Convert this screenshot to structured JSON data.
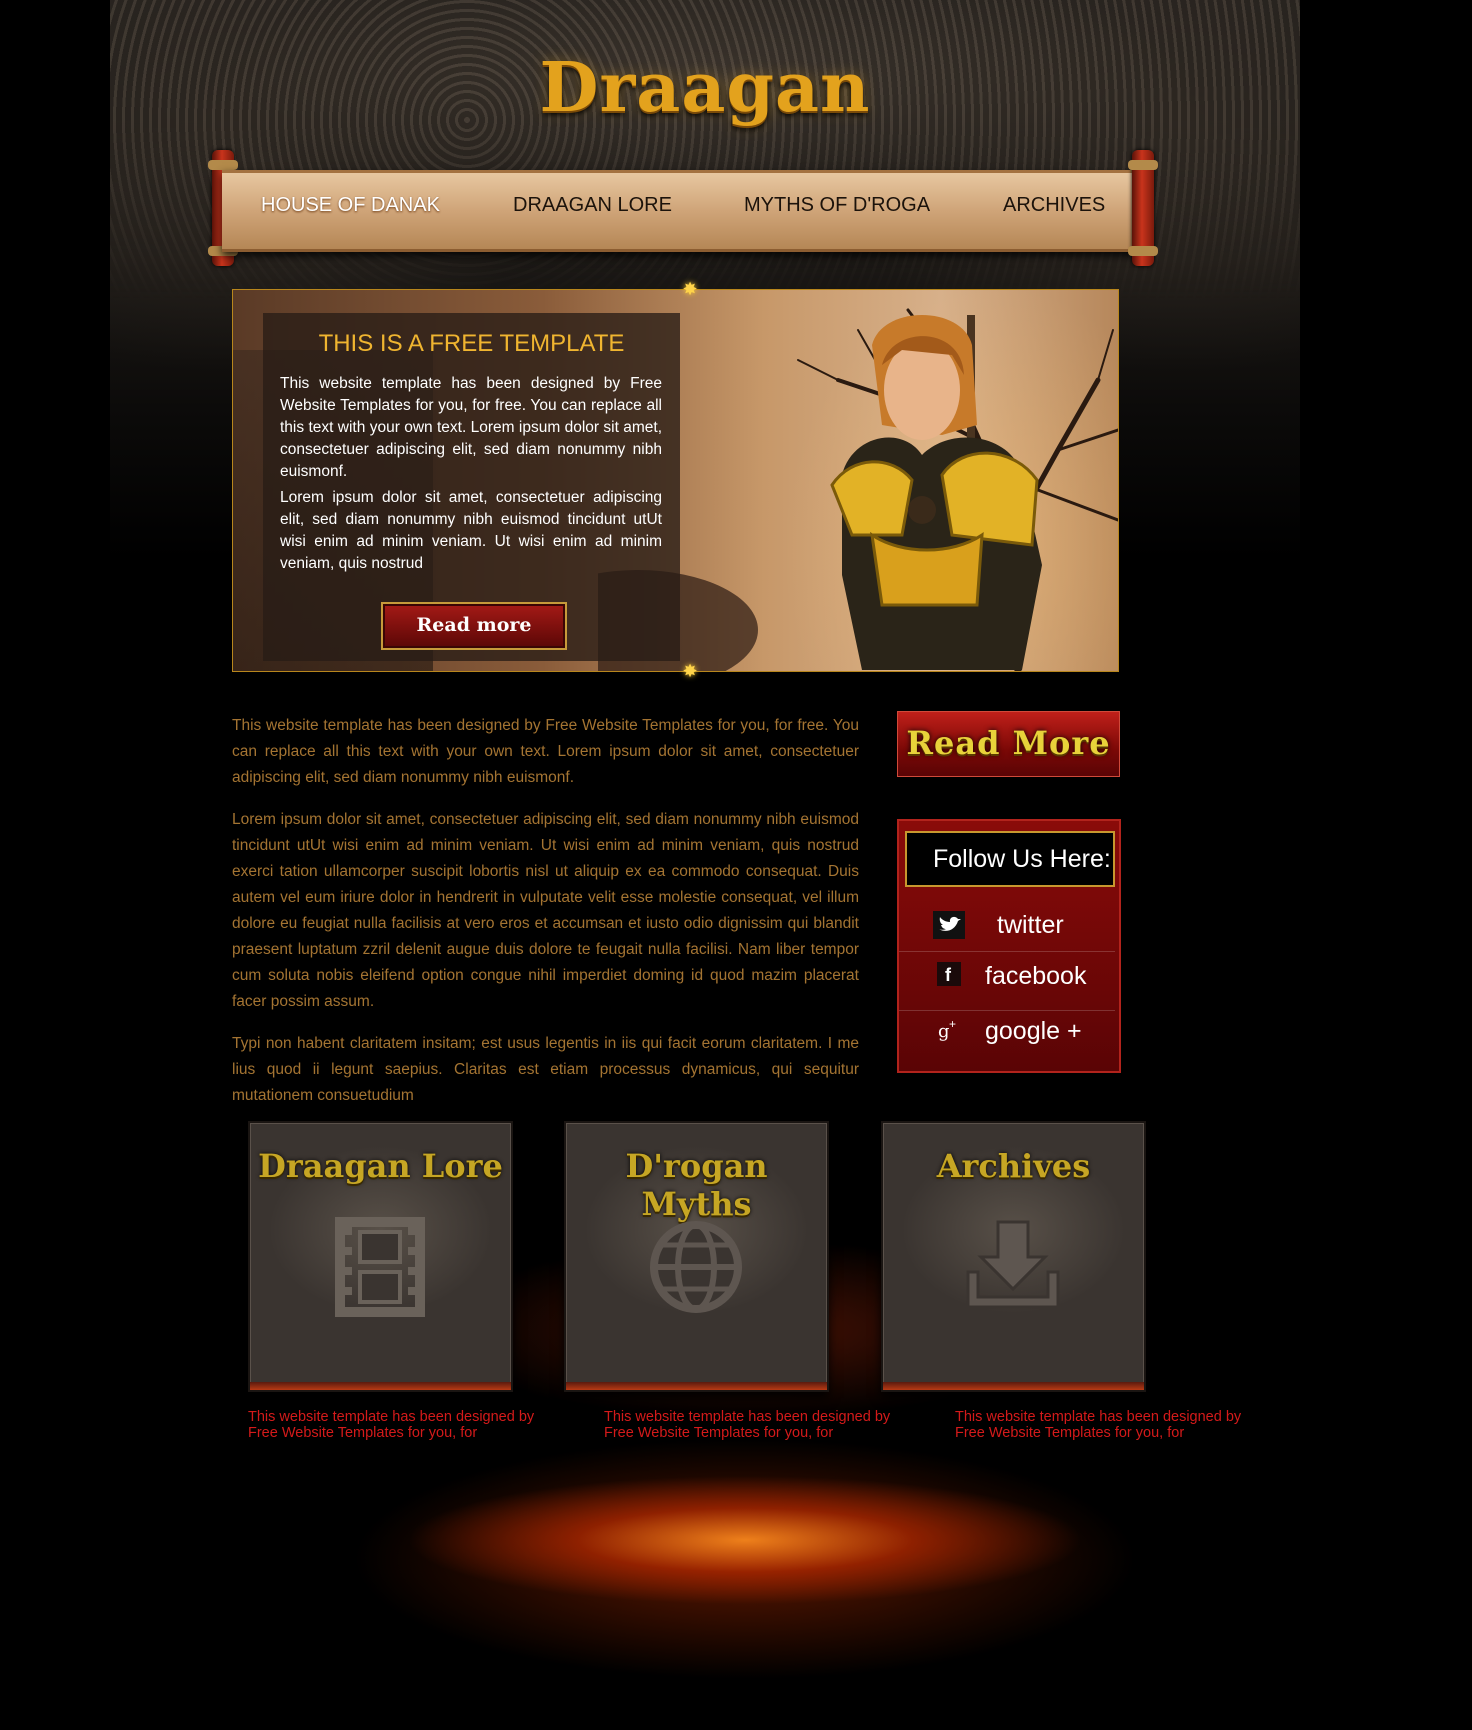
{
  "site": {
    "logo": "Draagan"
  },
  "nav": {
    "items": [
      {
        "label": "HOUSE OF DANAK",
        "active": true
      },
      {
        "label": "DRAAGAN LORE",
        "active": false
      },
      {
        "label": "MYTHS OF D'ROGA",
        "active": false
      },
      {
        "label": "ARCHIVES",
        "active": false
      }
    ]
  },
  "hero": {
    "title": "THIS IS A FREE TEMPLATE",
    "paragraph1": "This website template has been designed by Free Website Templates for you, for free. You can replace all this text with your own text. Lorem ipsum dolor sit amet, consectetuer adipiscing elit, sed diam nonummy nibh euismonf.",
    "paragraph2": "Lorem ipsum dolor sit amet, consectetuer adipiscing elit, sed diam nonummy nibh euismod tincidunt utUt wisi enim ad minim veniam. Ut wisi enim ad minim veniam, quis nostrud",
    "button_label": "Read more"
  },
  "main": {
    "paragraph1": "This website template has been designed by Free Website Templates for you, for free. You can replace all this text with your own text. Lorem ipsum dolor sit amet, consectetuer adipiscing elit, sed diam nonummy nibh euismonf.",
    "paragraph2": "Lorem ipsum dolor sit amet, consectetuer adipiscing elit, sed diam nonummy nibh euismod tincidunt utUt wisi enim ad minim veniam. Ut wisi enim ad minim veniam, quis nostrud exerci tation ullamcorper suscipit lobortis nisl ut aliquip ex ea commodo consequat. Duis autem vel eum iriure dolor in hendrerit in vulputate velit esse molestie consequat, vel illum dolore eu feugiat nulla facilisis at vero eros et accumsan et iusto odio dignissim qui blandit praesent luptatum zzril delenit augue duis dolore te feugait nulla facilisi. Nam liber tempor cum soluta nobis eleifend option congue nihil imperdiet doming id quod mazim placerat facer possim assum.",
    "paragraph3": "Typi non habent claritatem insitam; est usus legentis in iis qui facit eorum claritatem. I me lius quod ii legunt saepius. Claritas est etiam processus dynamicus, qui sequitur mutationem consuetudium"
  },
  "sidebar": {
    "read_more_label": "Read More",
    "follow_title": "Follow Us Here:",
    "social": [
      {
        "label": "twitter",
        "icon": "twitter-icon"
      },
      {
        "label": "facebook",
        "icon": "facebook-icon"
      },
      {
        "label": "google +",
        "icon": "google-plus-icon"
      }
    ]
  },
  "features": [
    {
      "title": "Draagan Lore",
      "icon": "film-strip-icon",
      "caption": "This website template has been designed by Free Website Templates for you, for"
    },
    {
      "title": "D'rogan Myths",
      "icon": "globe-icon",
      "caption": "This website template has been designed by Free Website Templates for you, for"
    },
    {
      "title": "Archives",
      "icon": "download-icon",
      "caption": "This website template has been designed by Free Website Templates for you, for"
    }
  ],
  "colors": {
    "accent": "#e3a21d",
    "body_text": "#a47432",
    "caption": "#d41a1a",
    "panel_red": "#8a0b09"
  }
}
